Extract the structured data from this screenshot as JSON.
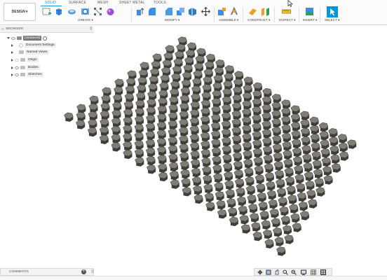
{
  "toolbar": {
    "design_label": "DESIGN",
    "design_caret": "▾",
    "tabs": [
      {
        "label": "SOLID",
        "active": true
      },
      {
        "label": "SURFACE",
        "active": false
      },
      {
        "label": "MESH",
        "active": false
      },
      {
        "label": "SHEET METAL",
        "active": false
      },
      {
        "label": "TOOLS",
        "active": false
      }
    ],
    "groups": [
      {
        "label": "CREATE ▾",
        "icons": [
          "create-sketch-icon",
          "extrude-icon",
          "revolve-icon",
          "hole-icon",
          "pattern-icon",
          "form-icon"
        ]
      },
      {
        "label": "MODIFY ▾",
        "icons": [
          "press-pull-icon",
          "fillet-icon",
          "chamfer-icon",
          "shell-icon",
          "combine-icon",
          "move-icon"
        ]
      },
      {
        "label": "ASSEMBLE ▾",
        "icons": [
          "new-component-icon",
          "joint-icon"
        ]
      },
      {
        "label": "CONSTRUCT ▾",
        "icons": [
          "offset-plane-icon",
          "midplane-icon"
        ]
      },
      {
        "label": "INSPECT ▾",
        "icons": [
          "measure-icon"
        ]
      },
      {
        "label": "INSERT ▾",
        "icons": [
          "insert-image-icon"
        ]
      },
      {
        "label": "SELECT ▾",
        "icons": [
          "select-icon"
        ]
      }
    ],
    "accent": "#0696d7"
  },
  "browser": {
    "title": "BROWSER",
    "collapse": "‹‹",
    "pin": "||",
    "root_label": "(Unsaved)",
    "items": [
      {
        "label": "Document Settings",
        "icon": "gear-icon"
      },
      {
        "label": "Named Views",
        "icon": "folder-icon"
      },
      {
        "label": "Origin",
        "icon": "folder-icon"
      },
      {
        "label": "Bodies",
        "icon": "folder-icon"
      },
      {
        "label": "Sketches",
        "icon": "folder-icon"
      }
    ]
  },
  "comments": {
    "title": "COMMENTS",
    "add": "+",
    "pin": "||"
  },
  "viewport": {
    "body_color": "#737068",
    "top_color": "#7f7d76",
    "side_color": "#3f3d39",
    "background": "#ffffff"
  }
}
